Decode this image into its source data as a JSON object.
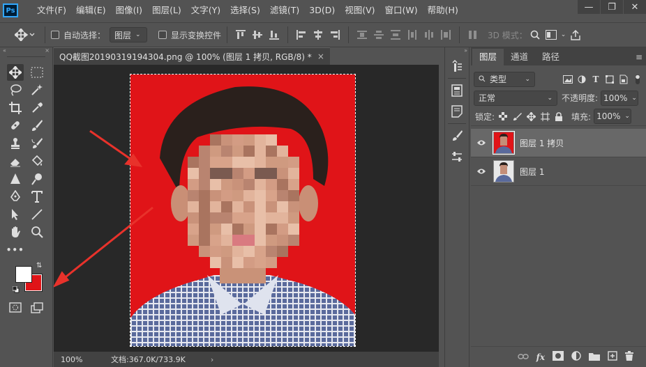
{
  "app": {
    "logo": "Ps"
  },
  "menu": [
    "文件(F)",
    "编辑(E)",
    "图像(I)",
    "图层(L)",
    "文字(Y)",
    "选择(S)",
    "滤镜(T)",
    "3D(D)",
    "视图(V)",
    "窗口(W)",
    "帮助(H)"
  ],
  "options": {
    "auto_select_label": "自动选择：",
    "auto_select_value": "图层",
    "show_transform_label": "显示变换控件",
    "mode_3d_label": "3D 模式："
  },
  "document": {
    "tab_title": "QQ截图20190319194304.png @ 100% (图层 1 拷贝, RGB/8) *",
    "close_glyph": "×"
  },
  "status": {
    "zoom": "100%",
    "doc_info": "文档:367.0K/733.9K",
    "arrow": "›"
  },
  "panel": {
    "tabs": [
      "图层",
      "通道",
      "路径"
    ],
    "filter_label": "类型",
    "blend_mode": "正常",
    "opacity_label": "不透明度:",
    "opacity_value": "100%",
    "lock_label": "锁定:",
    "fill_label": "填充:",
    "fill_value": "100%",
    "layers": [
      {
        "name": "图层 1 拷贝",
        "selected": true,
        "bg": "#e01418"
      },
      {
        "name": "图层 1",
        "selected": false,
        "bg": "#e8e8e8"
      }
    ]
  },
  "colors": {
    "foreground": "#ffffff",
    "background": "#e01418",
    "photo_background": "#e01418",
    "annotation_arrow": "#e8322b",
    "ps_blue": "#31a8ff"
  },
  "icons": {
    "fx": "fx"
  }
}
